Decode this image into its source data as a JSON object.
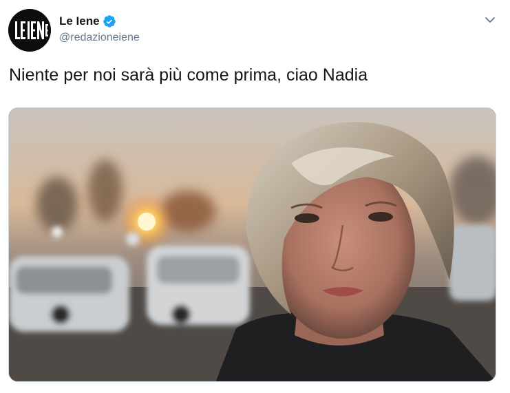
{
  "tweet": {
    "display_name": "Le Iene",
    "handle": "@redazioneiene",
    "text": "Niente per noi sarà più come prima, ciao Nadia",
    "verified": true,
    "avatar_logo_text": "LEIENE",
    "media": {
      "subject": "photo"
    }
  },
  "icons": {
    "verified": "verified-badge-icon",
    "more": "chevron-down-icon"
  },
  "colors": {
    "text_primary": "#14171a",
    "text_secondary": "#657786",
    "verified_blue": "#1da1f2",
    "border": "#ccd6dd"
  }
}
